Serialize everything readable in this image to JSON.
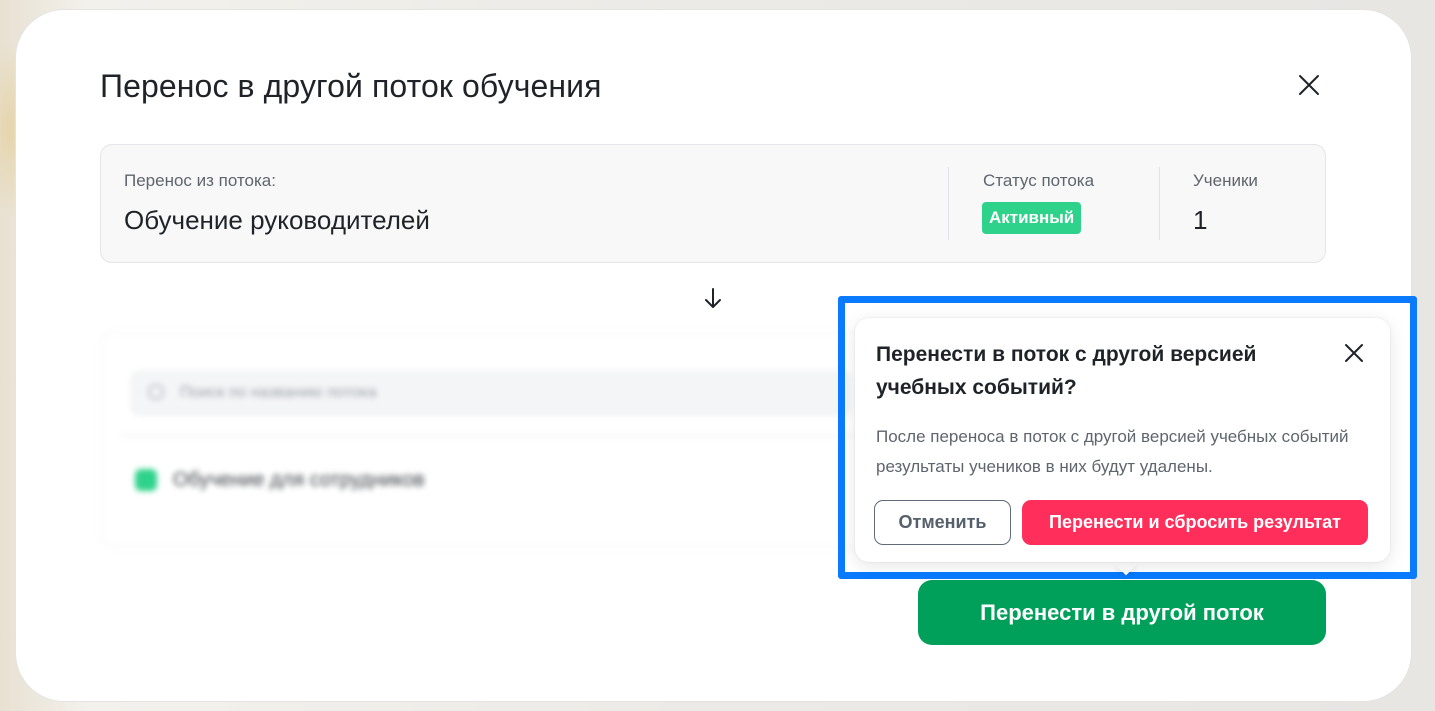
{
  "modal": {
    "title": "Перенос в другой поток обучения",
    "close_icon": "close-icon"
  },
  "source": {
    "label": "Перенос из потока:",
    "name": "Обучение руководителей",
    "status_label": "Статус потока",
    "status_value": "Активный",
    "status_color": "#2fd28b",
    "students_label": "Ученики",
    "students_count": "1"
  },
  "arrow_icon": "arrow-down-icon",
  "target": {
    "search_placeholder": "Поиск по названию потока",
    "list_item": "Обучение для сотрудников"
  },
  "primary_button": {
    "label": "Перенести в другой поток",
    "color": "#00a05a"
  },
  "popover": {
    "title": "Перенести в поток с другой версией учебных событий?",
    "body": "После переноса в поток с другой версией учебных событий результаты учеников в них будут удалены.",
    "cancel_label": "Отменить",
    "confirm_label": "Перенести и сбросить результат",
    "confirm_color": "#ff2e5b",
    "highlight_color": "#0a7bff"
  }
}
